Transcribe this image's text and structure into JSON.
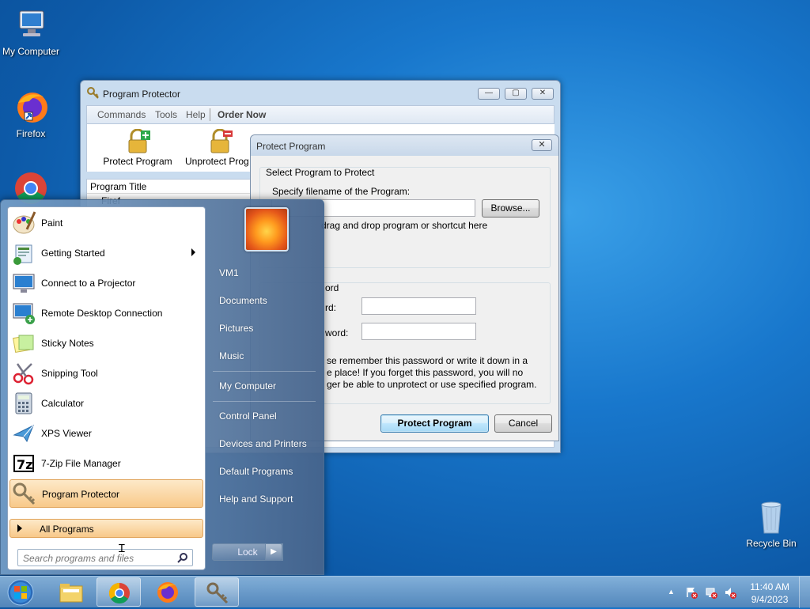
{
  "desktop": {
    "icons": [
      {
        "label": "My Computer"
      },
      {
        "label": "Firefox"
      },
      {
        "label": "Recycle Bin"
      }
    ]
  },
  "program_protector": {
    "title": "Program Protector",
    "menu": [
      "Commands",
      "Tools",
      "Help",
      "Order Now"
    ],
    "toolbar": {
      "protect": "Protect Program",
      "unprotect": "Unprotect Prog"
    },
    "list_header": "Program Title",
    "list_first_row": "Firef"
  },
  "dialog": {
    "title": "Protect Program",
    "close": "✕",
    "group1_title": "Select Program to Protect",
    "filename_label": "Specify filename of the Program:",
    "filename_value": "",
    "browse_button": "Browse...",
    "drag_hint": "drag and drop program or shortcut here",
    "group2_title_partial": "ord",
    "password_label_partial": "rd:",
    "confirm_label_partial": "word:",
    "password_value": "",
    "confirm_value": "",
    "warning_line1": "se remember this password or write it down in a",
    "warning_line2": "e place! If you forget this password, you will no",
    "warning_line3": "ger be able to unprotect or use specified program.",
    "protect_button": "Protect Program",
    "cancel_button": "Cancel"
  },
  "start_menu": {
    "programs": [
      {
        "label": "Paint",
        "icon": "paint-icon"
      },
      {
        "label": "Getting Started",
        "icon": "getting-started-icon",
        "submenu": true
      },
      {
        "label": "Connect to a Projector",
        "icon": "projector-icon"
      },
      {
        "label": "Remote Desktop Connection",
        "icon": "remote-desktop-icon"
      },
      {
        "label": "Sticky Notes",
        "icon": "sticky-notes-icon"
      },
      {
        "label": "Snipping Tool",
        "icon": "snipping-tool-icon"
      },
      {
        "label": "Calculator",
        "icon": "calculator-icon"
      },
      {
        "label": "XPS Viewer",
        "icon": "xps-viewer-icon"
      },
      {
        "label": "7-Zip File Manager",
        "icon": "7zip-icon"
      },
      {
        "label": "Program Protector",
        "icon": "program-protector-icon",
        "highlighted": true
      }
    ],
    "all_programs": "All Programs",
    "search_placeholder": "Search programs and files",
    "right_items": [
      "VM1",
      "Documents",
      "Pictures",
      "Music",
      "My Computer",
      "Control Panel",
      "Devices and Printers",
      "Default Programs",
      "Help and Support"
    ],
    "lock_button": "Lock"
  },
  "taskbar": {
    "apps": [
      "file-explorer-icon",
      "chrome-icon",
      "firefox-icon",
      "program-protector-icon"
    ],
    "time": "11:40 AM",
    "date": "9/4/2023"
  }
}
